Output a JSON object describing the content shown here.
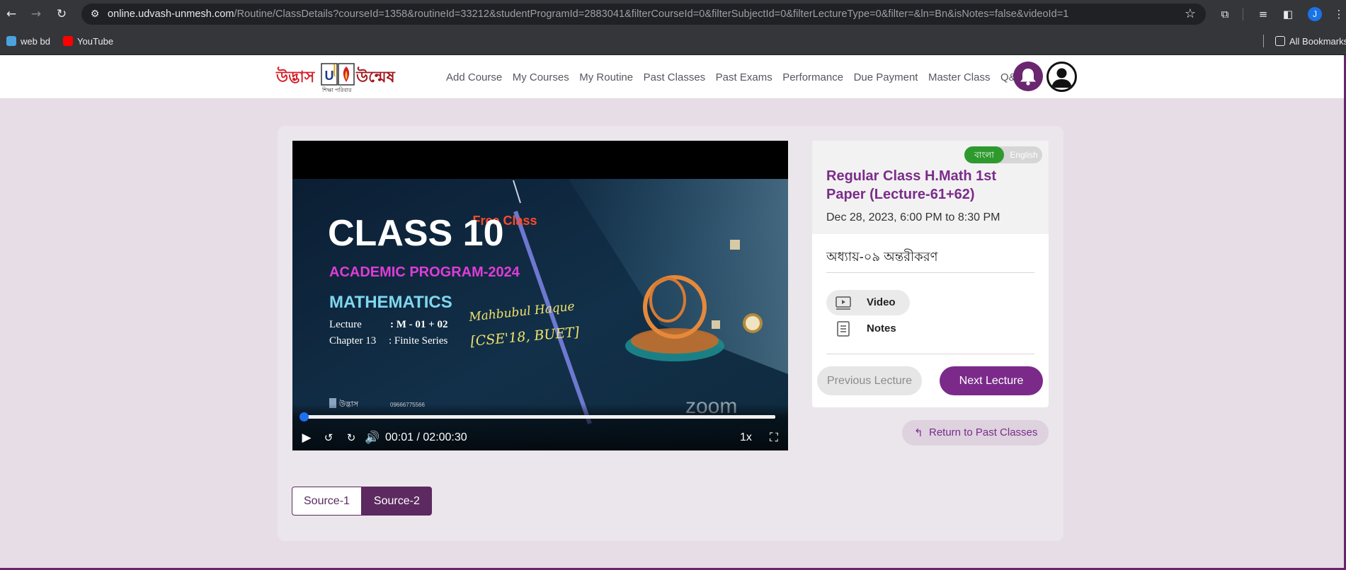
{
  "browser": {
    "url_host": "online.udvash-unmesh.com",
    "url_path": "/Routine/ClassDetails?courseId=1358&routineId=33212&studentProgramId=2883041&filterCourseId=0&filterSubjectId=0&filterLectureType=0&filter=&ln=Bn&isNotes=false&videoId=1",
    "profile_initial": "J",
    "bookmarks": [
      {
        "label": "web bd",
        "icon": "bookmark-favicon-icon",
        "color": "#4aa3df"
      },
      {
        "label": "YouTube",
        "icon": "youtube-icon",
        "color": "#ff0000"
      }
    ],
    "all_bookmarks": "All Bookmarks"
  },
  "site": {
    "logo_left": "উদ্ভাস",
    "logo_right": "উন্মেষ",
    "logo_tagline": "শিক্ষা পরিবার",
    "menu": [
      "Add Course",
      "My Courses",
      "My Routine",
      "Past Classes",
      "Past Exams",
      "Performance",
      "Due Payment",
      "Master Class",
      "Q&A"
    ],
    "brand_color": "#6b2670"
  },
  "player": {
    "poster": {
      "free_class": "Free Class",
      "class": "CLASS 10",
      "program": "ACADEMIC PROGRAM-2024",
      "subject": "MATHEMATICS",
      "lecture_label": "Lecture",
      "lecture_value": ": M - 01 + 02",
      "chapter_label": "Chapter 13",
      "chapter_value": ": Finite Series",
      "teacher": "Mahbubul Haque",
      "teacher_creds": "[CSE'18, BUET]",
      "footer_brand": "উদ্ভাস",
      "footer_phone": "09666775566",
      "watermark": "zoom"
    },
    "current_time": "00:01",
    "duration": "02:00:30",
    "progress": 0.0001,
    "speed": "1x"
  },
  "sources": [
    {
      "label": "Source-1",
      "active": false
    },
    {
      "label": "Source-2",
      "active": true
    }
  ],
  "lecture": {
    "lang_bn": "বাংলা",
    "lang_en": "English",
    "title": "Regular Class H.Math 1st Paper (Lecture-61+62)",
    "datetime": "Dec 28, 2023, 6:00 PM to 8:30 PM",
    "chapter": "অধ্যায়-০৯ অন্তরীকরণ",
    "resources": [
      {
        "label": "Video",
        "icon": "video-icon"
      },
      {
        "label": "Notes",
        "icon": "notes-icon"
      }
    ],
    "prev_label": "Previous Lecture",
    "next_label": "Next Lecture",
    "return_label": "Return to Past Classes"
  }
}
